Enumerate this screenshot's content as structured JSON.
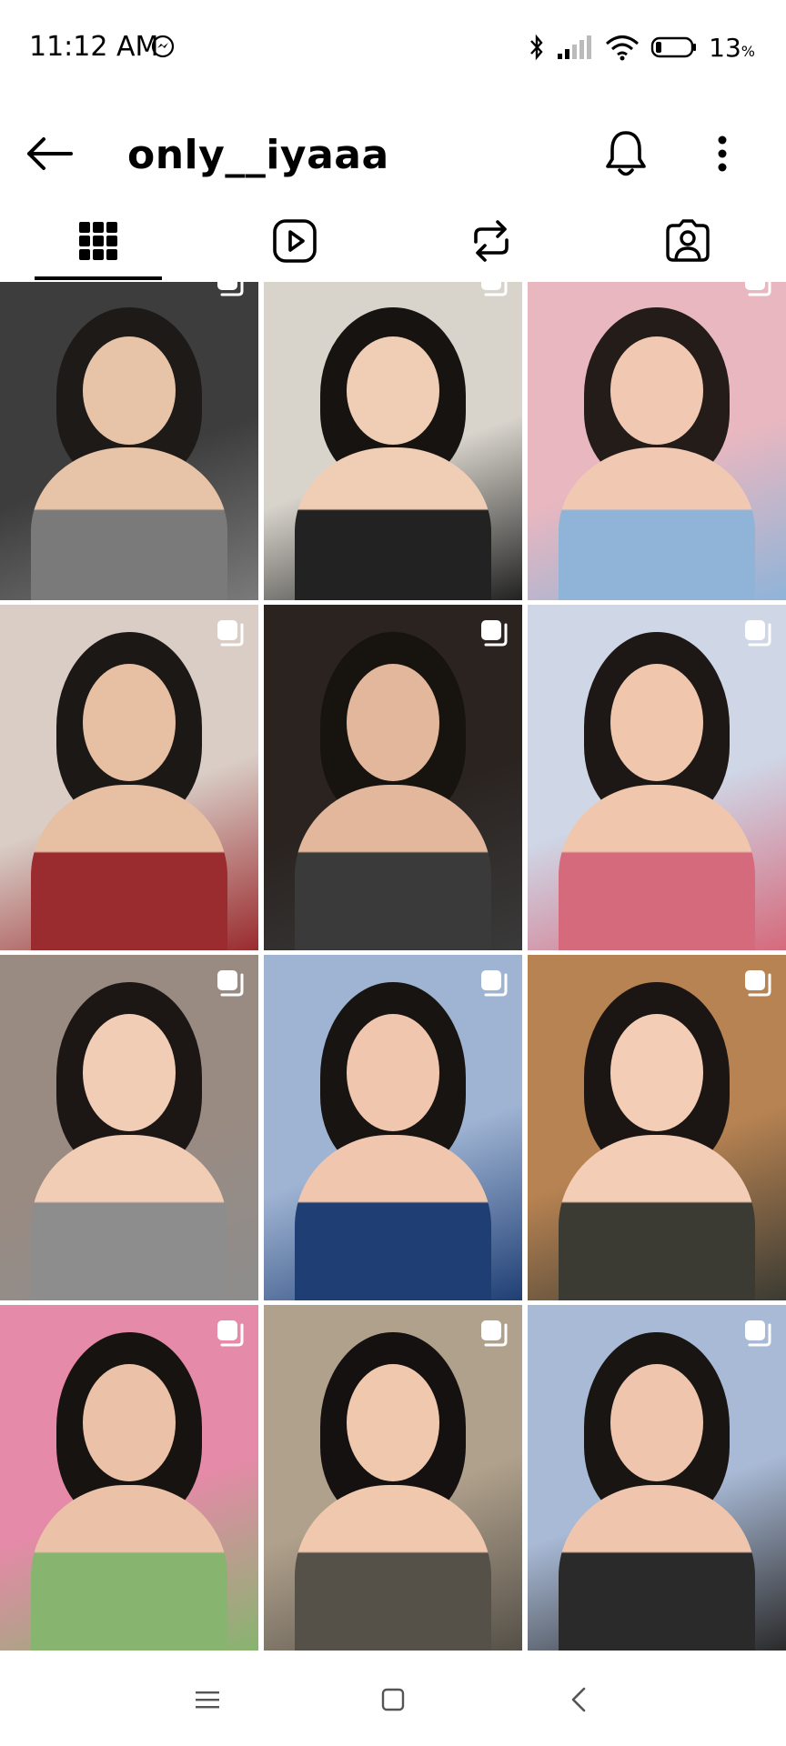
{
  "status_bar": {
    "time": "11:12 AM",
    "battery_percent": "13",
    "battery_unit": "%",
    "icons": [
      "messenger-icon",
      "bluetooth-icon",
      "signal-icon",
      "wifi-icon",
      "battery-icon"
    ]
  },
  "header": {
    "username": "only__iyaaa",
    "icons": [
      "back-arrow-icon",
      "bell-icon",
      "more-vertical-icon"
    ]
  },
  "tabs": [
    {
      "name": "posts",
      "icon": "grid-icon",
      "selected": true
    },
    {
      "name": "reels",
      "icon": "reels-icon",
      "selected": false
    },
    {
      "name": "reposts",
      "icon": "repost-icon",
      "selected": false
    },
    {
      "name": "tagged",
      "icon": "tagged-icon",
      "selected": false
    }
  ],
  "grid": {
    "columns": 3,
    "posts": [
      {
        "multi": true,
        "palette": [
          "#3d3d3d",
          "#7a7a7a",
          "#e7c3a8",
          "#1e1a18"
        ]
      },
      {
        "multi": true,
        "palette": [
          "#d8d4cc",
          "#222222",
          "#f0cdb5",
          "#161311"
        ]
      },
      {
        "multi": true,
        "palette": [
          "#e9b7c0",
          "#8fb4d8",
          "#f1c9b3",
          "#241c19"
        ]
      },
      {
        "multi": true,
        "palette": [
          "#d9cdc6",
          "#9a2b2e",
          "#e7c0a4",
          "#1b1816"
        ]
      },
      {
        "multi": true,
        "palette": [
          "#2a2320",
          "#3a3a3a",
          "#e3b79c",
          "#17130f"
        ]
      },
      {
        "multi": true,
        "palette": [
          "#cfd6e6",
          "#d56a7c",
          "#f0c7ad",
          "#1d1815"
        ]
      },
      {
        "multi": true,
        "palette": [
          "#9a8b82",
          "#8d8d8d",
          "#f2cdb6",
          "#1c1714"
        ]
      },
      {
        "multi": true,
        "palette": [
          "#9fb4d3",
          "#1f3f74",
          "#f1c6ae",
          "#181412"
        ]
      },
      {
        "multi": true,
        "palette": [
          "#b88352",
          "#3b3b33",
          "#f3cdb5",
          "#1b1614"
        ]
      },
      {
        "multi": true,
        "palette": [
          "#e58aa8",
          "#87b46f",
          "#ebc2a8",
          "#161311"
        ]
      },
      {
        "multi": true,
        "palette": [
          "#b0a18c",
          "#555048",
          "#f0c8ae",
          "#141110"
        ]
      },
      {
        "multi": true,
        "palette": [
          "#a9bad6",
          "#2a2a2a",
          "#efc6ad",
          "#191513"
        ]
      }
    ]
  },
  "nav_bar": {
    "icons": [
      "menu-icon",
      "home-square-icon",
      "back-chevron-icon"
    ]
  }
}
